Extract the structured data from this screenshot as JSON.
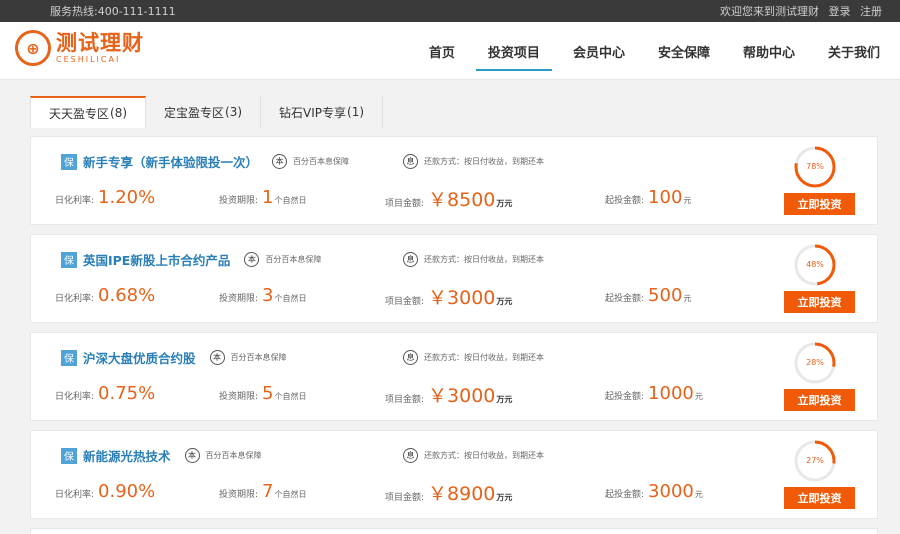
{
  "topbar": {
    "hotline": "服务热线:400-111-1111",
    "welcome": "欢迎您来到测试理财",
    "login": "登录",
    "register": "注册"
  },
  "logo": {
    "mark": "⊕",
    "cn": "测试理财",
    "en": "CESHILICAI"
  },
  "nav": [
    {
      "label": "首页"
    },
    {
      "label": "投资项目"
    },
    {
      "label": "会员中心"
    },
    {
      "label": "安全保障"
    },
    {
      "label": "帮助中心"
    },
    {
      "label": "关于我们"
    }
  ],
  "tabs": [
    {
      "label": "天天盈专区",
      "count": "(8)"
    },
    {
      "label": "定宝盈专区",
      "count": "(3)"
    },
    {
      "label": "钻石VIP专享",
      "count": "(1)"
    }
  ],
  "labels": {
    "bao": "保",
    "ben_icon": "本",
    "xi_icon": "息",
    "guarantee": "百分百本息保障",
    "repay": "还款方式：按日付收益，到期还本",
    "rate": "日化利率:",
    "term": "投资期限:",
    "term_unit": "个自然日",
    "amount": "项目金额:",
    "amount_unit": "万元",
    "min": "起投金额:",
    "min_unit": "元",
    "button": "立即投资"
  },
  "products": [
    {
      "name": "新手专享（新手体验限投一次）",
      "rate": "1.20%",
      "term": "1",
      "amount": "￥8500",
      "min": "100",
      "progress": 78,
      "progress_label": "78%"
    },
    {
      "name": "英国IPE新股上市合约产品",
      "rate": "0.68%",
      "term": "3",
      "amount": "￥3000",
      "min": "500",
      "progress": 48,
      "progress_label": "48%"
    },
    {
      "name": "沪深大盘优质合约股",
      "rate": "0.75%",
      "term": "5",
      "amount": "￥3000",
      "min": "1000",
      "progress": 28,
      "progress_label": "28%"
    },
    {
      "name": "新能源光热技术",
      "rate": "0.90%",
      "term": "7",
      "amount": "￥8900",
      "min": "3000",
      "progress": 27,
      "progress_label": "27%"
    }
  ],
  "colors": {
    "accent": "#f05a09",
    "link": "#2a7fb8",
    "ring_track": "#e8e8e8"
  }
}
